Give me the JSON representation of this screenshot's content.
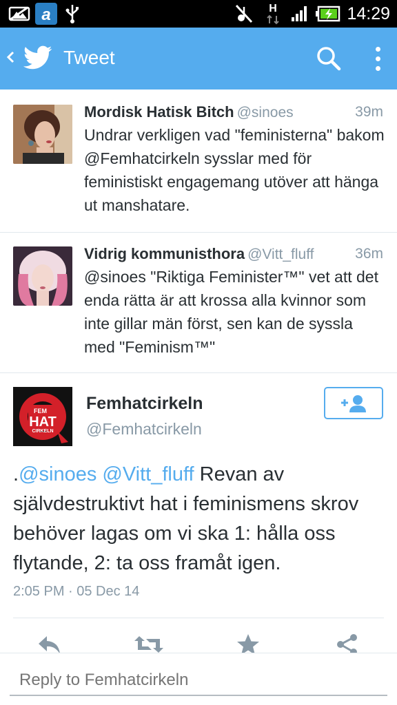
{
  "status_bar": {
    "time": "14:29",
    "icons": [
      "picture-icon",
      "app-a-icon",
      "usb-icon",
      "muted-icon",
      "data-h-icon",
      "signal-icon",
      "battery-charging-icon"
    ]
  },
  "action_bar": {
    "title": "Tweet",
    "back_icon": "chevron-left-icon",
    "search_icon": "search-icon",
    "overflow_icon": "more-vertical-icon",
    "accent": "#55acee"
  },
  "tweets": [
    {
      "name": "Mordisk Hatisk Bitch",
      "handle": "@sinoes",
      "time": "39m",
      "text": "Undrar verkligen vad \"feministerna\" bakom @Femhatcirkeln sysslar med för feministiskt engagemang utöver att hänga ut manshatare."
    },
    {
      "name": "Vidrig kommunisthora",
      "handle": "@Vitt_fluff",
      "time": "36m",
      "text": "@sinoes \"Riktiga Feminister™\" vet att det enda rätta är att krossa alla kvinnor som inte gillar män först, sen kan de syssla med \"Feminism™\""
    }
  ],
  "main_tweet": {
    "name": "Femhatcirkeln",
    "handle": "@Femhatcirkeln",
    "logo_text": [
      "FEM",
      "HAT",
      "CIRKELN"
    ],
    "mention_prefix": ".",
    "mention_1": "@sinoes",
    "mention_2": "@Vitt_fluff",
    "text": "Revan av självdestruktivt hat i feminismens skrov behöver lagas om vi ska 1: hålla oss flytande, 2: ta oss framåt igen.",
    "date": "2:05 PM · 05 Dec 14",
    "follow_icon": "add-user-icon",
    "actions": [
      "reply-icon",
      "retweet-icon",
      "favorite-star-icon",
      "share-icon"
    ]
  },
  "reply": {
    "placeholder": "Reply to Femhatcirkeln"
  }
}
